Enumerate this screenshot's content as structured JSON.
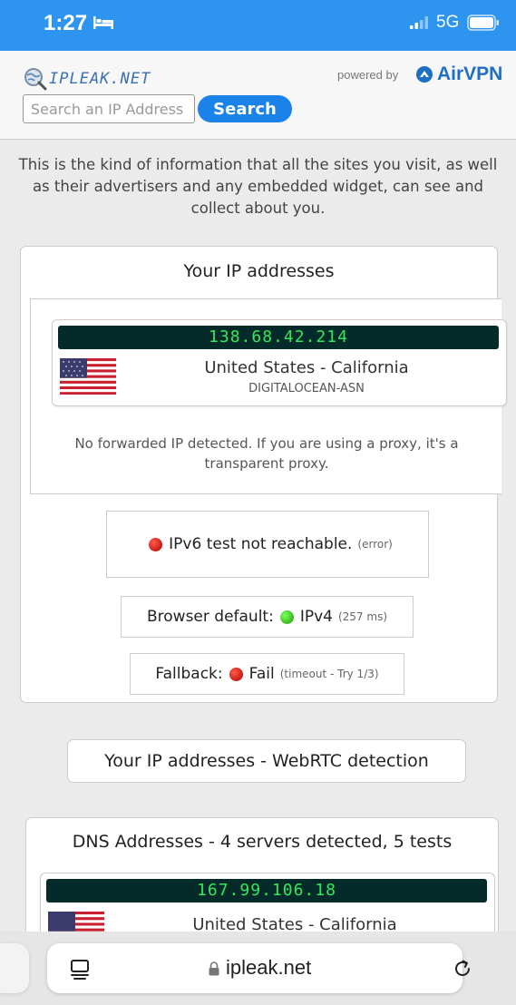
{
  "status_bar": {
    "time": "1:27",
    "network": "5G",
    "icons": [
      "bed-icon",
      "signal-icon",
      "battery-icon"
    ]
  },
  "header": {
    "logo_text": "IPLEAK.NET",
    "powered_by": "powered by",
    "brand": "AirVPN",
    "search": {
      "placeholder": "Search an IP Address",
      "button": "Search"
    }
  },
  "intro": "This is the kind of information that all the sites you visit, as well as their advertisers and any embedded widget, can see and collect about you.",
  "ip_section": {
    "title": "Your IP addresses",
    "ip": "138.68.42.214",
    "location": "United States - California",
    "asn": "DIGITALOCEAN-ASN",
    "forward_note": "No forwarded IP detected. If you are using a proxy, it's a transparent proxy.",
    "ipv6": {
      "label": "IPv6 test not reachable.",
      "detail": "(error)",
      "status": "red"
    },
    "browser_default": {
      "label": "Browser default:",
      "value": "IPv4",
      "detail": "(257 ms)",
      "status": "green"
    },
    "fallback": {
      "label": "Fallback:",
      "value": "Fail",
      "detail": "(timeout - Try 1/3)",
      "status": "red"
    }
  },
  "webrtc_button": "Your IP addresses - WebRTC detection",
  "dns_section": {
    "title": "DNS Addresses - 4 servers detected, 5 tests",
    "ip": "167.99.106.18",
    "location": "United States - California"
  },
  "browser_bar": {
    "url": "ipleak.net",
    "icons": [
      "tabs-icon",
      "lock-icon",
      "reload-icon"
    ]
  },
  "colors": {
    "status_bar": "#2d94f0",
    "search_button": "#1a82e8",
    "ip_bar_bg": "#042a2a",
    "ip_bar_text": "#35e85b",
    "brand": "#1e6fc3"
  }
}
